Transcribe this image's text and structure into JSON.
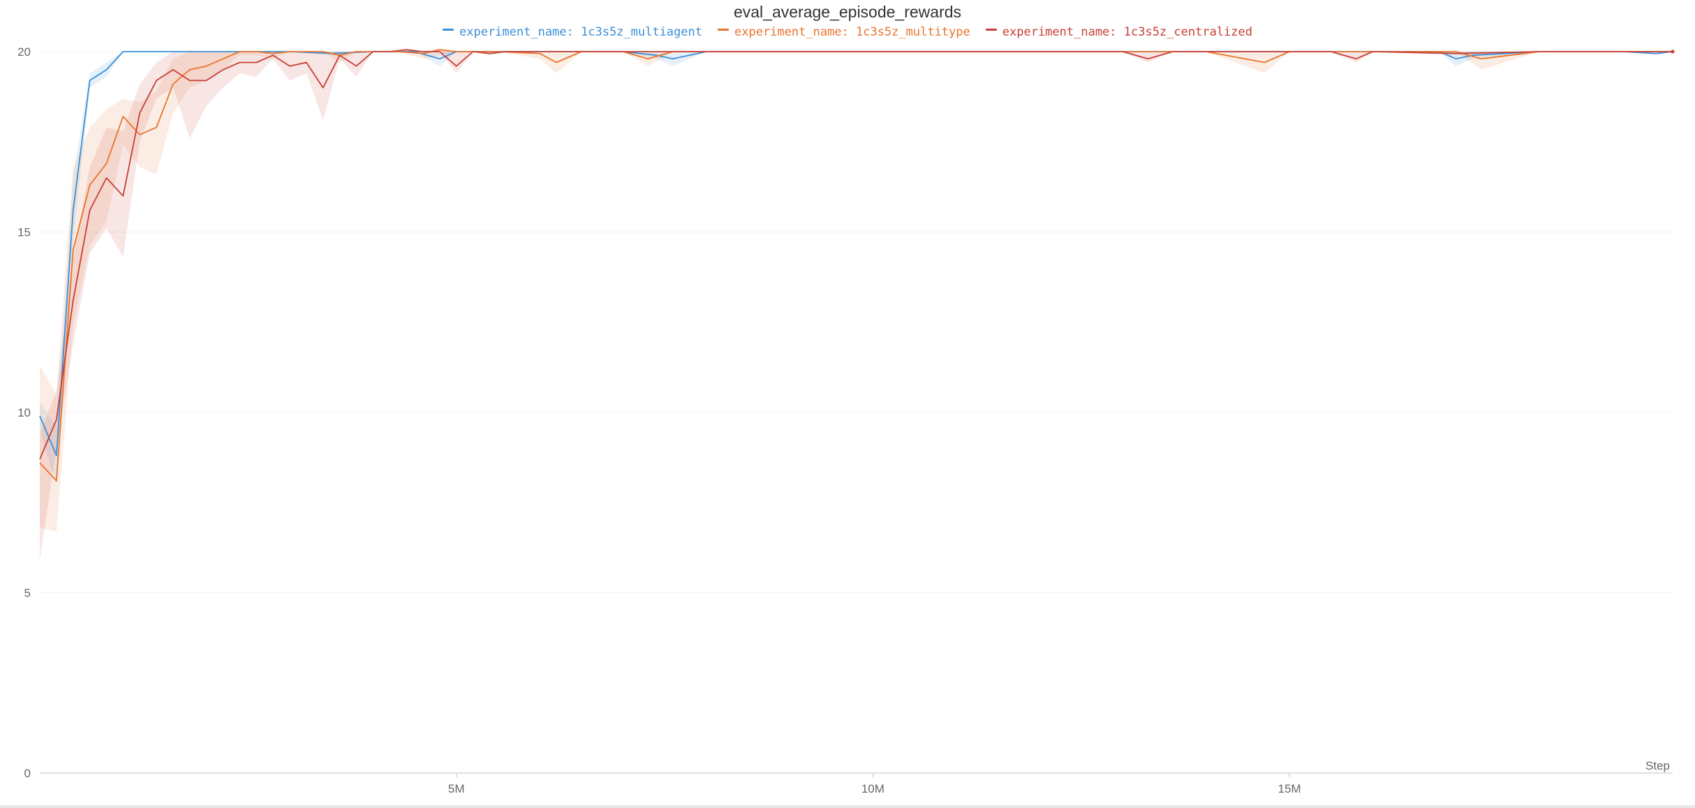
{
  "colors": {
    "multiagent": "#3b8ed6",
    "multitype": "#e8742c",
    "centralized": "#c73e33",
    "grid": "#f0f0f0",
    "axis": "#d6d6d6",
    "tick_text": "#666666"
  },
  "chart_data": {
    "type": "line",
    "title": "eval_average_episode_rewards",
    "xlabel": "Step",
    "ylabel": "",
    "xlim": [
      0,
      19600000
    ],
    "ylim": [
      0,
      20
    ],
    "grid": true,
    "legend_position": "top-center",
    "yticks": [
      {
        "value": 0,
        "label": "0"
      },
      {
        "value": 5,
        "label": "5"
      },
      {
        "value": 10,
        "label": "10"
      },
      {
        "value": 15,
        "label": "15"
      },
      {
        "value": 20,
        "label": "20"
      }
    ],
    "xticks": [
      {
        "value": 5000000,
        "label": "5M"
      },
      {
        "value": 10000000,
        "label": "10M"
      },
      {
        "value": 15000000,
        "label": "15M"
      }
    ],
    "series": [
      {
        "name": "experiment_name: 1c3s5z_multiagent",
        "color": "#3b8ed6",
        "x": [
          0,
          200000,
          400000,
          600000,
          800000,
          1000000,
          1200000,
          1500000,
          2000000,
          2500000,
          3000000,
          3500000,
          4000000,
          4500000,
          4800000,
          5000000,
          6000000,
          7000000,
          7400000,
          7600000,
          8000000,
          9000000,
          10000000,
          11000000,
          12000000,
          13000000,
          14000000,
          15000000,
          16000000,
          16800000,
          17000000,
          17200000,
          18000000,
          19000000,
          19400000,
          19600000
        ],
        "y": [
          9.9,
          8.8,
          15.6,
          19.2,
          19.5,
          20.0,
          20.0,
          20.0,
          20.0,
          20.0,
          20.0,
          19.95,
          20.0,
          20.0,
          19.8,
          20.0,
          20.0,
          20.0,
          19.9,
          19.8,
          20.0,
          20.0,
          20.0,
          20.0,
          20.0,
          20.0,
          20.0,
          20.0,
          20.0,
          20.0,
          19.8,
          19.9,
          20.0,
          20.0,
          19.95,
          20.0
        ],
        "band": {
          "upper": [
            10.3,
            9.6,
            16.5,
            19.4,
            19.7,
            20.0,
            20.0,
            20.0,
            20.0,
            20.0,
            20.0,
            20.0,
            20.0,
            20.0,
            20.0,
            20.0,
            20.0,
            20.0,
            20.0,
            20.0,
            20.0,
            20.0,
            20.0,
            20.0,
            20.0,
            20.0,
            20.0,
            20.0,
            20.0,
            20.0,
            20.0,
            20.0,
            20.0,
            20.0,
            20.0,
            20.0
          ],
          "lower": [
            9.5,
            8.0,
            14.7,
            19.0,
            19.3,
            20.0,
            20.0,
            20.0,
            20.0,
            20.0,
            20.0,
            19.9,
            20.0,
            20.0,
            19.6,
            20.0,
            20.0,
            20.0,
            19.8,
            19.6,
            20.0,
            20.0,
            20.0,
            20.0,
            20.0,
            20.0,
            20.0,
            20.0,
            20.0,
            20.0,
            19.6,
            19.8,
            20.0,
            20.0,
            19.9,
            20.0
          ]
        }
      },
      {
        "name": "experiment_name: 1c3s5z_multitype",
        "color": "#e8742c",
        "x": [
          0,
          200000,
          400000,
          600000,
          800000,
          1000000,
          1200000,
          1400000,
          1600000,
          1800000,
          2000000,
          2200000,
          2400000,
          2600000,
          2800000,
          3000000,
          3200000,
          3400000,
          3600000,
          3800000,
          4000000,
          4300000,
          4600000,
          4800000,
          5000000,
          5500000,
          6000000,
          6200000,
          6500000,
          7000000,
          7300000,
          7600000,
          8000000,
          9000000,
          10000000,
          12000000,
          13000000,
          14000000,
          14700000,
          15000000,
          16000000,
          17000000,
          17300000,
          18000000,
          19000000,
          19600000
        ],
        "y": [
          8.6,
          8.1,
          14.5,
          16.3,
          16.9,
          18.2,
          17.7,
          17.9,
          19.1,
          19.5,
          19.6,
          19.8,
          20.0,
          20.0,
          19.95,
          20.0,
          20.0,
          20.0,
          19.9,
          20.0,
          20.0,
          20.0,
          19.95,
          20.05,
          20.0,
          20.0,
          19.95,
          19.7,
          20.0,
          20.0,
          19.8,
          20.0,
          20.0,
          20.0,
          20.0,
          20.0,
          20.0,
          20.0,
          19.7,
          20.0,
          20.0,
          20.0,
          19.8,
          20.0,
          20.0,
          20.0
        ],
        "band": {
          "upper": [
            11.3,
            10.5,
            16.8,
            17.9,
            18.4,
            18.7,
            18.6,
            18.9,
            19.8,
            20.0,
            20.0,
            20.0,
            20.0,
            20.0,
            20.0,
            20.0,
            20.0,
            20.0,
            20.0,
            20.0,
            20.0,
            20.0,
            20.0,
            20.1,
            20.0,
            20.0,
            20.0,
            20.0,
            20.0,
            20.0,
            20.0,
            20.0,
            20.0,
            20.0,
            20.0,
            20.0,
            20.0,
            20.0,
            20.0,
            20.0,
            20.0,
            20.0,
            20.0,
            20.0,
            20.0,
            20.0
          ],
          "lower": [
            6.8,
            6.7,
            12.4,
            14.6,
            15.3,
            17.4,
            16.8,
            16.6,
            18.3,
            19.0,
            19.2,
            19.5,
            19.9,
            19.9,
            19.8,
            20.0,
            20.0,
            20.0,
            19.7,
            20.0,
            20.0,
            20.0,
            19.8,
            19.9,
            20.0,
            20.0,
            19.8,
            19.4,
            20.0,
            20.0,
            19.6,
            20.0,
            20.0,
            20.0,
            20.0,
            20.0,
            20.0,
            20.0,
            19.4,
            20.0,
            20.0,
            20.0,
            19.5,
            20.0,
            20.0,
            20.0
          ]
        }
      },
      {
        "name": "experiment_name: 1c3s5z_centralized",
        "color": "#c73e33",
        "x": [
          0,
          200000,
          400000,
          600000,
          800000,
          1000000,
          1200000,
          1400000,
          1600000,
          1800000,
          2000000,
          2200000,
          2400000,
          2600000,
          2800000,
          3000000,
          3200000,
          3400000,
          3600000,
          3800000,
          4000000,
          4200000,
          4400000,
          4600000,
          4800000,
          5000000,
          5200000,
          5400000,
          5600000,
          6000000,
          7000000,
          8000000,
          9000000,
          10000000,
          11000000,
          12000000,
          13000000,
          13300000,
          13600000,
          14000000,
          15000000,
          15500000,
          15800000,
          16000000,
          17000000,
          18000000,
          19000000,
          19600000
        ],
        "y": [
          8.7,
          9.8,
          13.1,
          15.6,
          16.5,
          16.0,
          18.3,
          19.2,
          19.5,
          19.2,
          19.2,
          19.5,
          19.7,
          19.7,
          19.9,
          19.6,
          19.7,
          19.0,
          19.9,
          19.6,
          20.0,
          20.0,
          20.05,
          20.0,
          20.0,
          19.6,
          20.0,
          19.95,
          20.0,
          20.0,
          20.0,
          20.0,
          20.0,
          20.0,
          20.0,
          20.0,
          20.0,
          19.8,
          20.0,
          20.0,
          20.0,
          20.0,
          19.8,
          20.0,
          19.95,
          20.0,
          20.0,
          20.0
        ],
        "band": {
          "upper": [
            9.4,
            10.6,
            14.3,
            16.8,
            17.9,
            17.8,
            19.1,
            19.7,
            20.0,
            20.0,
            20.0,
            20.0,
            20.0,
            20.0,
            20.0,
            20.0,
            20.0,
            20.0,
            20.0,
            20.0,
            20.0,
            20.0,
            20.1,
            20.0,
            20.0,
            20.0,
            20.0,
            20.0,
            20.0,
            20.0,
            20.0,
            20.0,
            20.0,
            20.0,
            20.0,
            20.0,
            20.0,
            20.0,
            20.0,
            20.0,
            20.0,
            20.0,
            20.0,
            20.0,
            20.0,
            20.0,
            20.0,
            20.0
          ],
          "lower": [
            5.9,
            9.0,
            11.9,
            14.4,
            15.1,
            14.3,
            17.5,
            18.7,
            19.0,
            17.6,
            18.5,
            19.0,
            19.4,
            19.3,
            19.8,
            19.2,
            19.4,
            18.1,
            19.8,
            19.3,
            20.0,
            20.0,
            20.0,
            20.0,
            20.0,
            19.4,
            20.0,
            19.9,
            20.0,
            20.0,
            20.0,
            20.0,
            20.0,
            20.0,
            20.0,
            20.0,
            20.0,
            19.7,
            20.0,
            20.0,
            20.0,
            20.0,
            19.7,
            20.0,
            19.9,
            20.0,
            20.0,
            20.0
          ]
        }
      }
    ]
  }
}
